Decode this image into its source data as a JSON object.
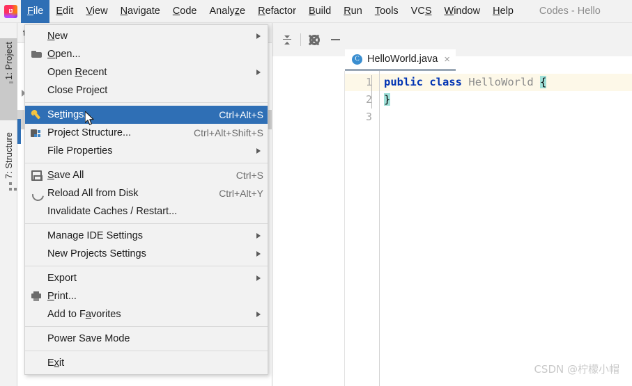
{
  "window": {
    "title": "Codes - Hello",
    "logo_icon": "intellij-idea-logo"
  },
  "menubar": {
    "items": [
      {
        "label": "File",
        "mnemonic": "F",
        "active": true
      },
      {
        "label": "Edit",
        "mnemonic": "E",
        "active": false
      },
      {
        "label": "View",
        "mnemonic": "V",
        "active": false
      },
      {
        "label": "Navigate",
        "mnemonic": "N",
        "active": false
      },
      {
        "label": "Code",
        "mnemonic": "C",
        "active": false
      },
      {
        "label": "Analyze",
        "mnemonic": "z",
        "active": false
      },
      {
        "label": "Refactor",
        "mnemonic": "R",
        "active": false
      },
      {
        "label": "Build",
        "mnemonic": "B",
        "active": false
      },
      {
        "label": "Run",
        "mnemonic": "R",
        "active": false
      },
      {
        "label": "Tools",
        "mnemonic": "T",
        "active": false
      },
      {
        "label": "VCS",
        "mnemonic": "S",
        "active": false
      },
      {
        "label": "Window",
        "mnemonic": "W",
        "active": false
      },
      {
        "label": "Help",
        "mnemonic": "H",
        "active": false
      }
    ]
  },
  "file_menu": {
    "items": [
      {
        "label": "New",
        "accel": "",
        "submenu": true,
        "icon": "",
        "selected": false,
        "separator_after": false
      },
      {
        "label": "Open...",
        "accel": "",
        "submenu": false,
        "icon": "open-folder-icon",
        "selected": false,
        "separator_after": false
      },
      {
        "label": "Open Recent",
        "accel": "",
        "submenu": true,
        "icon": "",
        "selected": false,
        "separator_after": false
      },
      {
        "label": "Close Project",
        "accel": "",
        "submenu": false,
        "icon": "",
        "selected": false,
        "separator_after": true
      },
      {
        "label": "Settings...",
        "accel": "Ctrl+Alt+S",
        "submenu": false,
        "icon": "wrench-icon",
        "selected": true,
        "separator_after": false
      },
      {
        "label": "Project Structure...",
        "accel": "Ctrl+Alt+Shift+S",
        "submenu": false,
        "icon": "project-structure-icon",
        "selected": false,
        "separator_after": false
      },
      {
        "label": "File Properties",
        "accel": "",
        "submenu": true,
        "icon": "",
        "selected": false,
        "separator_after": true
      },
      {
        "label": "Save All",
        "accel": "Ctrl+S",
        "submenu": false,
        "icon": "save-icon",
        "selected": false,
        "separator_after": false
      },
      {
        "label": "Reload All from Disk",
        "accel": "Ctrl+Alt+Y",
        "submenu": false,
        "icon": "reload-icon",
        "selected": false,
        "separator_after": false
      },
      {
        "label": "Invalidate Caches / Restart...",
        "accel": "",
        "submenu": false,
        "icon": "",
        "selected": false,
        "separator_after": true
      },
      {
        "label": "Manage IDE Settings",
        "accel": "",
        "submenu": true,
        "icon": "",
        "selected": false,
        "separator_after": false
      },
      {
        "label": "New Projects Settings",
        "accel": "",
        "submenu": true,
        "icon": "",
        "selected": false,
        "separator_after": true
      },
      {
        "label": "Export",
        "accel": "",
        "submenu": true,
        "icon": "",
        "selected": false,
        "separator_after": false
      },
      {
        "label": "Print...",
        "accel": "",
        "submenu": false,
        "icon": "printer-icon",
        "selected": false,
        "separator_after": false
      },
      {
        "label": "Add to Favorites",
        "accel": "",
        "submenu": true,
        "icon": "",
        "selected": false,
        "separator_after": true
      },
      {
        "label": "Power Save Mode",
        "accel": "",
        "submenu": false,
        "icon": "",
        "selected": false,
        "separator_after": true
      },
      {
        "label": "Exit",
        "accel": "",
        "submenu": false,
        "icon": "",
        "selected": false,
        "separator_after": false
      }
    ]
  },
  "toolstrip": {
    "tabs": [
      {
        "label": "1: Project",
        "icon": "folder-icon",
        "selected": true
      },
      {
        "label": "7: Structure",
        "icon": "structure-icon",
        "selected": false
      }
    ]
  },
  "project_panel": {
    "header": "tes"
  },
  "editor_toolbar": {
    "buttons": [
      {
        "name": "collapse-all-button",
        "icon": "collapse-all-icon"
      },
      {
        "name": "settings-button",
        "icon": "gear-icon"
      },
      {
        "name": "hide-button",
        "icon": "minus-icon"
      }
    ]
  },
  "editor": {
    "tab": {
      "label": "HelloWorld.java",
      "icon_letter": "C",
      "close_label": "×"
    },
    "line_numbers": [
      "1",
      "2",
      "3"
    ],
    "code": {
      "line1_kw1": "public",
      "line1_kw2": "class",
      "line1_name": "HelloWorld",
      "line1_brace": "{",
      "line2_brace": "}"
    },
    "colors": {
      "keyword": "#0033b3",
      "classname": "#8c8c8c",
      "brace_highlight": "#9fe0d8",
      "current_line": "#fdf8e8"
    }
  },
  "watermark": {
    "text": "CSDN @柠檬小帽"
  },
  "theme": {
    "accent": "#2f6fb5",
    "menu_bg": "#f2f2f2",
    "panel_border": "#cfcfcf"
  }
}
